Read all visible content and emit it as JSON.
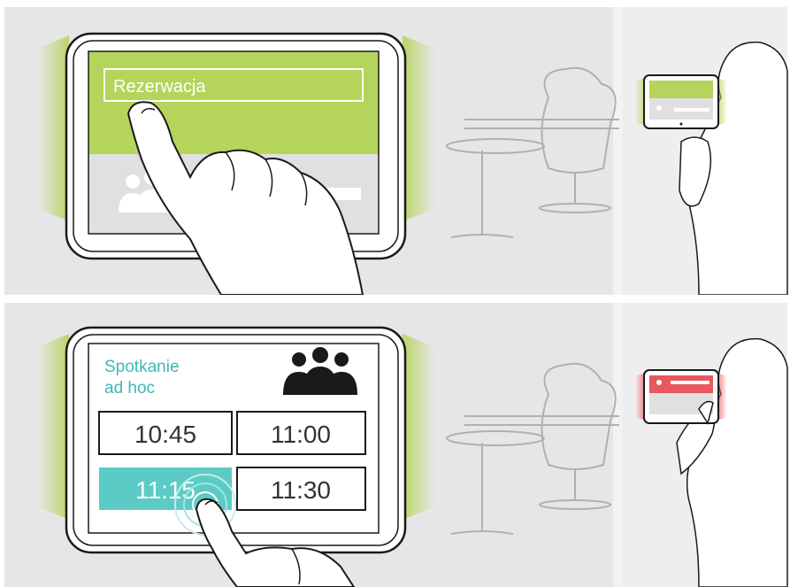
{
  "top_panel": {
    "button_label": "Rezerwacja"
  },
  "bottom_panel": {
    "title_line1": "Spotkanie",
    "title_line2": "ad hoc",
    "times": [
      "10:45",
      "11:00",
      "11:15",
      "11:30"
    ],
    "selected_time": "11:15"
  },
  "colors": {
    "background": "#e6e6e6",
    "green_accent": "#b5d45b",
    "teal_accent": "#5ccbc5",
    "red_accent": "#e8585c",
    "outline": "#1a1a1a"
  }
}
